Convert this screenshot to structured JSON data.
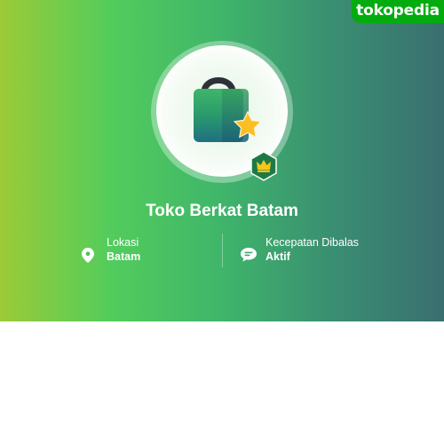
{
  "brand": {
    "logo_text": "tokopedia",
    "color": "#03ac0e"
  },
  "shop": {
    "name": "Toko Berkat Batam",
    "badge_icon": "crown-badge-icon",
    "avatar_icon": "shopping-bag-star-icon"
  },
  "info": {
    "location": {
      "label": "Lokasi",
      "value": "Batam",
      "icon": "location-pin-icon"
    },
    "response": {
      "label": "Kecepatan Dibalas",
      "value": "Aktif",
      "icon": "chat-bubble-icon"
    }
  },
  "colors": {
    "gradient_start": "#9ccb36",
    "gradient_mid": "#52cc5c",
    "gradient_end": "#3a6f70",
    "badge": "#1e7a45",
    "star": "#fbbf24"
  }
}
